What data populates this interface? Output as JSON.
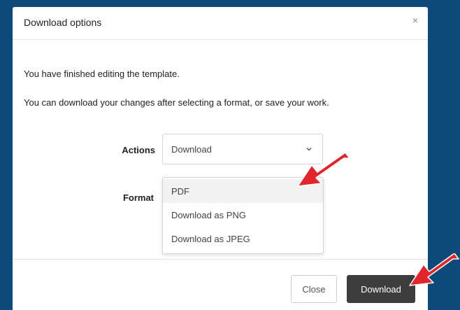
{
  "dialog": {
    "title": "Download options",
    "close_glyph": "×"
  },
  "body": {
    "line1": "You have finished editing the template.",
    "line2": "You can download your changes after selecting a format, or save your work."
  },
  "form": {
    "actions_label": "Actions",
    "actions_value": "Download",
    "format_label": "Format",
    "format_options": [
      "PDF",
      "Download as PNG",
      "Download as JPEG"
    ],
    "highlighted_option": "PDF"
  },
  "footer": {
    "close_label": "Close",
    "download_label": "Download"
  },
  "colors": {
    "page_background": "#0d4a7a",
    "annotation_arrow": "#e0262b",
    "primary_button": "#3d3d3d"
  },
  "icons": {
    "dialog_close": "close-icon",
    "select_chevron": "chevron-down-icon",
    "annotation": "red-arrow-icon"
  }
}
